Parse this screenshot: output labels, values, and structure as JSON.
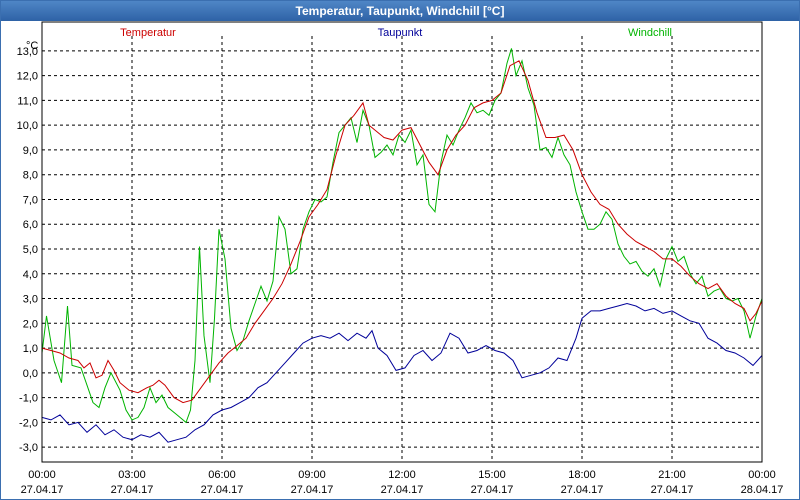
{
  "window": {
    "title": "Temperatur, Taupunkt, Windchill [°C]"
  },
  "chart_data": {
    "type": "line",
    "title": "Temperatur, Taupunkt, Windchill [°C]",
    "ylabel": "°C",
    "ylim": [
      -3.6,
      13.6
    ],
    "yticks": [
      -3.0,
      -2.0,
      -1.0,
      0.0,
      1.0,
      2.0,
      3.0,
      4.0,
      5.0,
      6.0,
      7.0,
      8.0,
      9.0,
      10.0,
      11.0,
      12.0,
      13.0
    ],
    "ytick_labels": [
      "-3,0",
      "-2,0",
      "-1,0",
      "0,0",
      "1,0",
      "2,0",
      "3,0",
      "4,0",
      "5,0",
      "6,0",
      "7,0",
      "8,0",
      "9,0",
      "10,0",
      "11,0",
      "12,0",
      "13,0"
    ],
    "xlim": [
      0,
      24
    ],
    "xticks": [
      0,
      3,
      6,
      9,
      12,
      15,
      18,
      21,
      24
    ],
    "xtick_labels": [
      [
        "00:00",
        "27.04.17"
      ],
      [
        "03:00",
        "27.04.17"
      ],
      [
        "06:00",
        "27.04.17"
      ],
      [
        "09:00",
        "27.04.17"
      ],
      [
        "12:00",
        "27.04.17"
      ],
      [
        "15:00",
        "27.04.17"
      ],
      [
        "18:00",
        "27.04.17"
      ],
      [
        "21:00",
        "27.04.17"
      ],
      [
        "00:00",
        "28.04.17"
      ]
    ],
    "grid": true,
    "series": [
      {
        "name": "Temperatur",
        "color": "#cc0000",
        "points": [
          [
            0,
            1.0
          ],
          [
            0.3,
            0.9
          ],
          [
            0.6,
            0.8
          ],
          [
            0.9,
            0.6
          ],
          [
            1.2,
            0.5
          ],
          [
            1.4,
            0.2
          ],
          [
            1.6,
            0.4
          ],
          [
            1.8,
            -0.2
          ],
          [
            2.0,
            -0.1
          ],
          [
            2.2,
            0.5
          ],
          [
            2.4,
            0.1
          ],
          [
            2.6,
            -0.4
          ],
          [
            2.9,
            -0.7
          ],
          [
            3.2,
            -0.8
          ],
          [
            3.5,
            -0.6
          ],
          [
            3.7,
            -0.5
          ],
          [
            3.9,
            -0.3
          ],
          [
            4.1,
            -0.5
          ],
          [
            4.4,
            -1.0
          ],
          [
            4.7,
            -1.2
          ],
          [
            5.0,
            -1.1
          ],
          [
            5.3,
            -0.6
          ],
          [
            5.6,
            -0.1
          ],
          [
            5.9,
            0.4
          ],
          [
            6.2,
            0.8
          ],
          [
            6.5,
            1.1
          ],
          [
            6.8,
            1.4
          ],
          [
            7.1,
            2.0
          ],
          [
            7.4,
            2.5
          ],
          [
            7.7,
            3.0
          ],
          [
            8.0,
            3.6
          ],
          [
            8.3,
            4.4
          ],
          [
            8.6,
            5.3
          ],
          [
            8.9,
            6.3
          ],
          [
            9.2,
            6.8
          ],
          [
            9.5,
            7.4
          ],
          [
            9.8,
            8.8
          ],
          [
            10.1,
            10.0
          ],
          [
            10.4,
            10.4
          ],
          [
            10.7,
            10.9
          ],
          [
            10.9,
            10.0
          ],
          [
            11.1,
            9.8
          ],
          [
            11.4,
            9.5
          ],
          [
            11.7,
            9.4
          ],
          [
            12.0,
            9.8
          ],
          [
            12.3,
            9.9
          ],
          [
            12.6,
            9.2
          ],
          [
            12.9,
            8.5
          ],
          [
            13.2,
            8.0
          ],
          [
            13.5,
            9.0
          ],
          [
            13.8,
            9.6
          ],
          [
            14.1,
            10.0
          ],
          [
            14.4,
            10.7
          ],
          [
            14.7,
            10.9
          ],
          [
            15.0,
            11.0
          ],
          [
            15.3,
            11.3
          ],
          [
            15.6,
            12.4
          ],
          [
            15.9,
            12.6
          ],
          [
            16.2,
            11.8
          ],
          [
            16.5,
            10.5
          ],
          [
            16.8,
            9.5
          ],
          [
            17.1,
            9.5
          ],
          [
            17.4,
            9.6
          ],
          [
            17.7,
            9.0
          ],
          [
            18.0,
            8.0
          ],
          [
            18.3,
            7.3
          ],
          [
            18.6,
            6.8
          ],
          [
            18.9,
            6.6
          ],
          [
            19.2,
            6.0
          ],
          [
            19.5,
            5.6
          ],
          [
            19.8,
            5.3
          ],
          [
            20.1,
            5.1
          ],
          [
            20.4,
            4.9
          ],
          [
            20.7,
            4.6
          ],
          [
            21.0,
            4.6
          ],
          [
            21.3,
            4.3
          ],
          [
            21.6,
            3.9
          ],
          [
            21.9,
            3.6
          ],
          [
            22.2,
            3.4
          ],
          [
            22.5,
            3.6
          ],
          [
            22.8,
            3.1
          ],
          [
            23.1,
            2.8
          ],
          [
            23.4,
            2.6
          ],
          [
            23.6,
            2.1
          ],
          [
            23.8,
            2.4
          ],
          [
            24.0,
            2.9
          ]
        ]
      },
      {
        "name": "Taupunkt",
        "color": "#000099",
        "points": [
          [
            0,
            -1.8
          ],
          [
            0.3,
            -1.9
          ],
          [
            0.6,
            -1.7
          ],
          [
            0.9,
            -2.1
          ],
          [
            1.2,
            -2.0
          ],
          [
            1.5,
            -2.4
          ],
          [
            1.8,
            -2.1
          ],
          [
            2.1,
            -2.5
          ],
          [
            2.4,
            -2.3
          ],
          [
            2.7,
            -2.6
          ],
          [
            3.0,
            -2.7
          ],
          [
            3.3,
            -2.5
          ],
          [
            3.6,
            -2.6
          ],
          [
            3.9,
            -2.4
          ],
          [
            4.2,
            -2.8
          ],
          [
            4.5,
            -2.7
          ],
          [
            4.8,
            -2.6
          ],
          [
            5.1,
            -2.3
          ],
          [
            5.4,
            -2.1
          ],
          [
            5.7,
            -1.7
          ],
          [
            6.0,
            -1.5
          ],
          [
            6.3,
            -1.4
          ],
          [
            6.6,
            -1.2
          ],
          [
            6.9,
            -1.0
          ],
          [
            7.2,
            -0.6
          ],
          [
            7.5,
            -0.4
          ],
          [
            7.8,
            0.0
          ],
          [
            8.1,
            0.4
          ],
          [
            8.4,
            0.8
          ],
          [
            8.7,
            1.2
          ],
          [
            9.0,
            1.4
          ],
          [
            9.3,
            1.5
          ],
          [
            9.6,
            1.4
          ],
          [
            9.9,
            1.6
          ],
          [
            10.2,
            1.3
          ],
          [
            10.5,
            1.6
          ],
          [
            10.8,
            1.4
          ],
          [
            11.0,
            1.7
          ],
          [
            11.2,
            1.0
          ],
          [
            11.5,
            0.7
          ],
          [
            11.8,
            0.1
          ],
          [
            12.1,
            0.2
          ],
          [
            12.4,
            0.7
          ],
          [
            12.7,
            0.9
          ],
          [
            13.0,
            0.5
          ],
          [
            13.3,
            0.8
          ],
          [
            13.6,
            1.6
          ],
          [
            13.9,
            1.4
          ],
          [
            14.2,
            0.8
          ],
          [
            14.5,
            0.9
          ],
          [
            14.8,
            1.1
          ],
          [
            15.1,
            0.9
          ],
          [
            15.4,
            0.8
          ],
          [
            15.7,
            0.5
          ],
          [
            16.0,
            -0.2
          ],
          [
            16.3,
            -0.1
          ],
          [
            16.6,
            0.0
          ],
          [
            16.9,
            0.2
          ],
          [
            17.2,
            0.6
          ],
          [
            17.5,
            0.5
          ],
          [
            17.8,
            1.4
          ],
          [
            18.0,
            2.2
          ],
          [
            18.3,
            2.5
          ],
          [
            18.6,
            2.5
          ],
          [
            18.9,
            2.6
          ],
          [
            19.2,
            2.7
          ],
          [
            19.5,
            2.8
          ],
          [
            19.8,
            2.7
          ],
          [
            20.1,
            2.5
          ],
          [
            20.4,
            2.6
          ],
          [
            20.7,
            2.4
          ],
          [
            21.0,
            2.5
          ],
          [
            21.3,
            2.3
          ],
          [
            21.6,
            2.1
          ],
          [
            21.9,
            2.0
          ],
          [
            22.2,
            1.4
          ],
          [
            22.5,
            1.2
          ],
          [
            22.8,
            0.9
          ],
          [
            23.1,
            0.8
          ],
          [
            23.4,
            0.6
          ],
          [
            23.7,
            0.3
          ],
          [
            24.0,
            0.7
          ]
        ]
      },
      {
        "name": "Windchill",
        "color": "#00b400",
        "points": [
          [
            0,
            0.8
          ],
          [
            0.15,
            2.3
          ],
          [
            0.4,
            0.5
          ],
          [
            0.65,
            -0.4
          ],
          [
            0.85,
            2.7
          ],
          [
            1.0,
            0.3
          ],
          [
            1.3,
            0.2
          ],
          [
            1.5,
            -0.5
          ],
          [
            1.7,
            -1.2
          ],
          [
            1.9,
            -1.4
          ],
          [
            2.1,
            -0.6
          ],
          [
            2.3,
            0.0
          ],
          [
            2.6,
            -0.7
          ],
          [
            2.8,
            -1.5
          ],
          [
            3.0,
            -1.9
          ],
          [
            3.2,
            -1.8
          ],
          [
            3.4,
            -1.4
          ],
          [
            3.6,
            -0.6
          ],
          [
            3.8,
            -1.2
          ],
          [
            4.0,
            -0.9
          ],
          [
            4.2,
            -1.4
          ],
          [
            4.5,
            -1.7
          ],
          [
            4.8,
            -2.0
          ],
          [
            4.95,
            -1.5
          ],
          [
            5.1,
            0.5
          ],
          [
            5.25,
            5.1
          ],
          [
            5.4,
            1.5
          ],
          [
            5.6,
            -0.4
          ],
          [
            5.75,
            2.2
          ],
          [
            5.9,
            5.8
          ],
          [
            6.1,
            4.6
          ],
          [
            6.3,
            1.8
          ],
          [
            6.5,
            0.9
          ],
          [
            6.7,
            1.3
          ],
          [
            6.9,
            2.1
          ],
          [
            7.1,
            2.8
          ],
          [
            7.3,
            3.5
          ],
          [
            7.5,
            2.9
          ],
          [
            7.7,
            3.7
          ],
          [
            7.9,
            6.3
          ],
          [
            8.1,
            5.8
          ],
          [
            8.3,
            4.0
          ],
          [
            8.5,
            4.2
          ],
          [
            8.7,
            5.8
          ],
          [
            8.9,
            6.5
          ],
          [
            9.1,
            7.0
          ],
          [
            9.3,
            6.9
          ],
          [
            9.5,
            7.1
          ],
          [
            9.7,
            8.5
          ],
          [
            9.9,
            9.7
          ],
          [
            10.1,
            10.0
          ],
          [
            10.3,
            10.3
          ],
          [
            10.5,
            9.3
          ],
          [
            10.7,
            10.6
          ],
          [
            10.9,
            10.0
          ],
          [
            11.1,
            8.7
          ],
          [
            11.3,
            8.9
          ],
          [
            11.5,
            9.2
          ],
          [
            11.7,
            8.8
          ],
          [
            11.9,
            9.6
          ],
          [
            12.1,
            9.3
          ],
          [
            12.3,
            9.8
          ],
          [
            12.5,
            8.4
          ],
          [
            12.7,
            8.8
          ],
          [
            12.9,
            6.8
          ],
          [
            13.1,
            6.5
          ],
          [
            13.3,
            8.5
          ],
          [
            13.5,
            9.6
          ],
          [
            13.7,
            9.2
          ],
          [
            13.9,
            9.8
          ],
          [
            14.1,
            10.3
          ],
          [
            14.3,
            10.9
          ],
          [
            14.5,
            10.5
          ],
          [
            14.7,
            10.6
          ],
          [
            14.9,
            10.4
          ],
          [
            15.1,
            11.0
          ],
          [
            15.3,
            11.3
          ],
          [
            15.5,
            12.5
          ],
          [
            15.65,
            13.1
          ],
          [
            15.8,
            12.0
          ],
          [
            16.0,
            12.6
          ],
          [
            16.2,
            11.5
          ],
          [
            16.4,
            10.8
          ],
          [
            16.6,
            9.0
          ],
          [
            16.8,
            9.1
          ],
          [
            17.0,
            8.7
          ],
          [
            17.2,
            9.5
          ],
          [
            17.4,
            8.8
          ],
          [
            17.6,
            8.4
          ],
          [
            17.8,
            7.3
          ],
          [
            18.0,
            6.5
          ],
          [
            18.2,
            5.8
          ],
          [
            18.4,
            5.8
          ],
          [
            18.6,
            6.0
          ],
          [
            18.8,
            6.5
          ],
          [
            19.0,
            6.2
          ],
          [
            19.2,
            5.2
          ],
          [
            19.4,
            4.7
          ],
          [
            19.6,
            4.4
          ],
          [
            19.8,
            4.5
          ],
          [
            20.0,
            4.1
          ],
          [
            20.2,
            3.9
          ],
          [
            20.4,
            4.2
          ],
          [
            20.6,
            3.5
          ],
          [
            20.8,
            4.6
          ],
          [
            21.0,
            5.1
          ],
          [
            21.2,
            4.5
          ],
          [
            21.4,
            4.7
          ],
          [
            21.6,
            4.0
          ],
          [
            21.8,
            3.6
          ],
          [
            22.0,
            3.9
          ],
          [
            22.2,
            3.1
          ],
          [
            22.4,
            3.3
          ],
          [
            22.6,
            3.4
          ],
          [
            22.8,
            3.0
          ],
          [
            23.0,
            2.9
          ],
          [
            23.2,
            3.0
          ],
          [
            23.4,
            2.5
          ],
          [
            23.6,
            1.4
          ],
          [
            23.8,
            2.3
          ],
          [
            24.0,
            3.0
          ]
        ]
      }
    ]
  }
}
